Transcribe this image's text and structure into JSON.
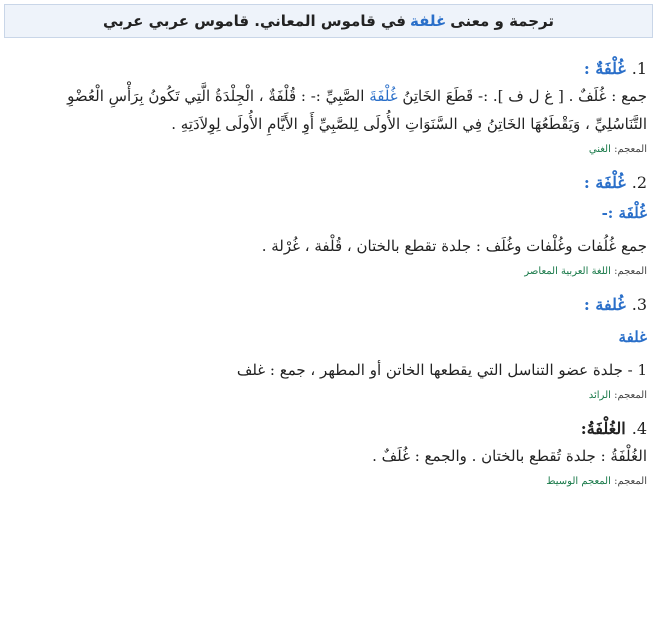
{
  "header": {
    "before": "ترجمة و معنى",
    "keyword": "غلفة",
    "after": "في قاموس المعاني. قاموس عربي عربي"
  },
  "dict_label": "المعجم:",
  "entries": [
    {
      "num": "1.",
      "word": "غُلْفَةٌ :",
      "body_a": "جمع : غُلَفٌ . [ غ ل ف ]. :- قَطَعَ الخَاتِنُ",
      "body_kw": "غُلْفَةَ",
      "body_b": "الصَّبِيِّ :- : قُلْفَةٌ ، الْجِلْدَةُ الَّتِي تَكُونُ بِرَأْسِ الْعُضْوِ التَّنَاسُلِيِّ ، وَيَقْطَعُهَا الخَاتِنُ فِي السَّنَوَاتِ الأُولَى لِلصَّبِيِّ أَوِ الأَيَّامِ الأُولَى لِوِلاَدَتِهِ .",
      "dict": "الغني"
    },
    {
      "num": "2.",
      "word": "غُلْفَة :",
      "sub": "غُلْفَة :-",
      "body": "جمع غُلُفات وغُلْفات وغُلَف : جلدة تقطع بالختان ، قُلْفة ، غُرْلة .",
      "dict": "اللغة العربية المعاصر"
    },
    {
      "num": "3.",
      "word": "غُلفة :",
      "sub": "غلفة",
      "body": "1 - جلدة عضو التناسل التي يقطعها الخاتن أو المطهر ، جمع : غلف",
      "dict": "الرائد"
    },
    {
      "num": "4.",
      "word": "الغُلْفَةُ:",
      "body": "الغُلْفَةُ : جلدة تُقطع بالختان . والجمع : غُلَفٌ .",
      "dict": "المعجم الوسيط"
    }
  ]
}
